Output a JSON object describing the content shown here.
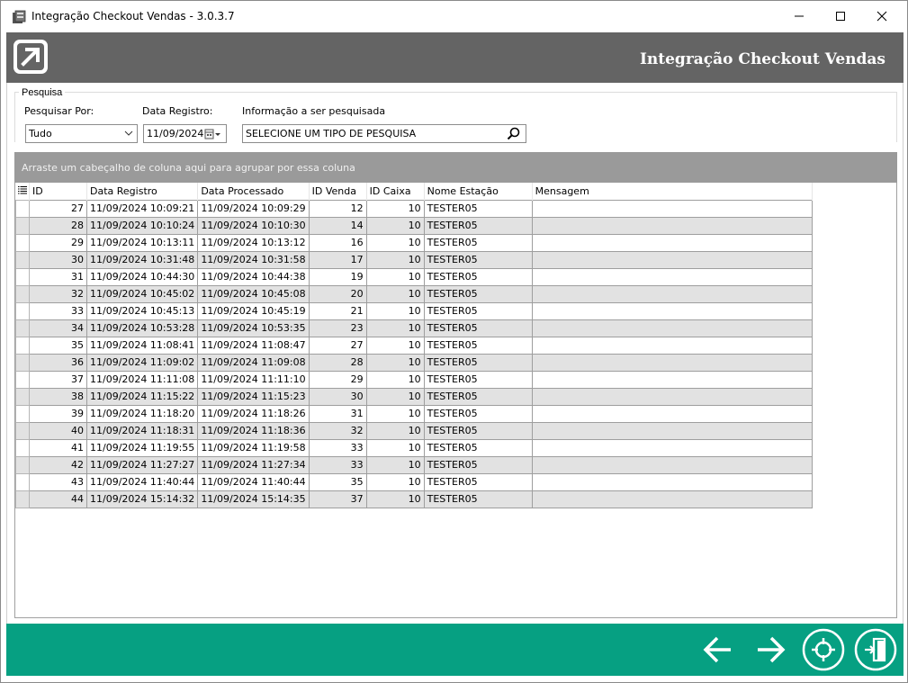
{
  "window": {
    "title": "Integração Checkout Vendas - 3.0.3.7"
  },
  "header": {
    "title": "Integração Checkout Vendas"
  },
  "search": {
    "group_label": "Pesquisa",
    "search_by_label": "Pesquisar Por:",
    "search_by_value": "Tudo",
    "date_label": "Data Registro:",
    "date_value": "11/09/2024",
    "info_label": "Informação a ser pesquisada",
    "info_value": "SELECIONE UM TIPO DE PESQUISA"
  },
  "grid": {
    "group_hint": "Arraste um cabeçalho de coluna aqui para agrupar por essa coluna",
    "columns": [
      "ID",
      "Data Registro",
      "Data Processado",
      "ID Venda",
      "ID Caixa",
      "Nome Estação",
      "Mensagem"
    ],
    "rows": [
      [
        "27",
        "11/09/2024 10:09:21",
        "11/09/2024 10:09:29",
        "12",
        "10",
        "TESTER05",
        ""
      ],
      [
        "28",
        "11/09/2024 10:10:24",
        "11/09/2024 10:10:30",
        "14",
        "10",
        "TESTER05",
        ""
      ],
      [
        "29",
        "11/09/2024 10:13:11",
        "11/09/2024 10:13:12",
        "16",
        "10",
        "TESTER05",
        ""
      ],
      [
        "30",
        "11/09/2024 10:31:48",
        "11/09/2024 10:31:58",
        "17",
        "10",
        "TESTER05",
        ""
      ],
      [
        "31",
        "11/09/2024 10:44:30",
        "11/09/2024 10:44:38",
        "19",
        "10",
        "TESTER05",
        ""
      ],
      [
        "32",
        "11/09/2024 10:45:02",
        "11/09/2024 10:45:08",
        "20",
        "10",
        "TESTER05",
        ""
      ],
      [
        "33",
        "11/09/2024 10:45:13",
        "11/09/2024 10:45:19",
        "21",
        "10",
        "TESTER05",
        ""
      ],
      [
        "34",
        "11/09/2024 10:53:28",
        "11/09/2024 10:53:35",
        "23",
        "10",
        "TESTER05",
        ""
      ],
      [
        "35",
        "11/09/2024 11:08:41",
        "11/09/2024 11:08:47",
        "27",
        "10",
        "TESTER05",
        ""
      ],
      [
        "36",
        "11/09/2024 11:09:02",
        "11/09/2024 11:09:08",
        "28",
        "10",
        "TESTER05",
        ""
      ],
      [
        "37",
        "11/09/2024 11:11:08",
        "11/09/2024 11:11:10",
        "29",
        "10",
        "TESTER05",
        ""
      ],
      [
        "38",
        "11/09/2024 11:15:22",
        "11/09/2024 11:15:23",
        "30",
        "10",
        "TESTER05",
        ""
      ],
      [
        "39",
        "11/09/2024 11:18:20",
        "11/09/2024 11:18:26",
        "31",
        "10",
        "TESTER05",
        ""
      ],
      [
        "40",
        "11/09/2024 11:18:31",
        "11/09/2024 11:18:36",
        "32",
        "10",
        "TESTER05",
        ""
      ],
      [
        "41",
        "11/09/2024 11:19:55",
        "11/09/2024 11:19:58",
        "33",
        "10",
        "TESTER05",
        ""
      ],
      [
        "42",
        "11/09/2024 11:27:27",
        "11/09/2024 11:27:34",
        "33",
        "10",
        "TESTER05",
        ""
      ],
      [
        "43",
        "11/09/2024 11:40:44",
        "11/09/2024 11:40:44",
        "35",
        "10",
        "TESTER05",
        ""
      ],
      [
        "44",
        "11/09/2024 15:14:32",
        "11/09/2024 15:14:35",
        "37",
        "10",
        "TESTER05",
        ""
      ]
    ]
  },
  "footer": {
    "buttons": [
      "arrow-left-icon",
      "arrow-right-icon",
      "crosshair-icon",
      "exit-door-icon"
    ]
  },
  "colors": {
    "header_bg": "#646464",
    "footer_bg": "#06a082",
    "groupby_bg": "#9a9a9a",
    "row_alt": "#e2e2e2"
  }
}
